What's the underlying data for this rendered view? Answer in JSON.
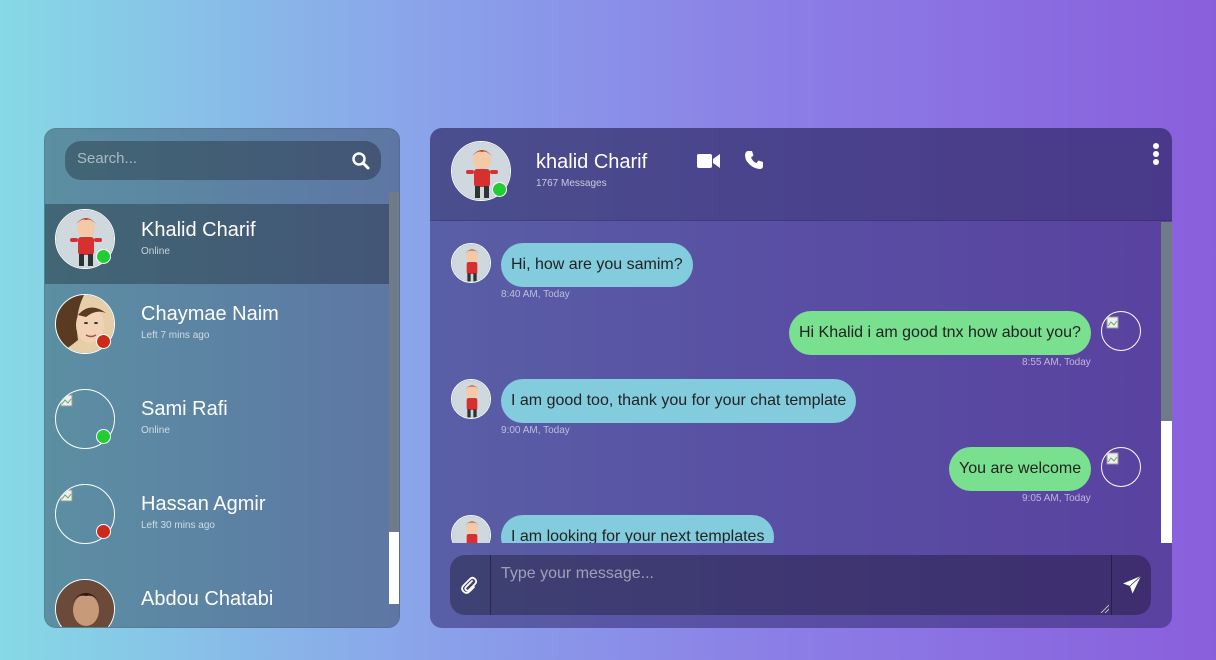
{
  "search": {
    "placeholder": "Search...",
    "icon": "search-icon"
  },
  "contacts": [
    {
      "name": "Khalid Charif",
      "status": "Online",
      "status_color": "#22cc33",
      "avatar": "cartoon-boy",
      "active": true
    },
    {
      "name": "Chaymae Naim",
      "status": "Left 7 mins ago",
      "status_color": "#cc2a1a",
      "avatar": "photo-woman",
      "active": false
    },
    {
      "name": "Sami Rafi",
      "status": "Online",
      "status_color": "#22cc33",
      "avatar": "broken-image",
      "active": false
    },
    {
      "name": "Hassan Agmir",
      "status": "Left 30 mins ago",
      "status_color": "#cc2a1a",
      "avatar": "broken-image",
      "active": false
    },
    {
      "name": "Abdou Chatabi",
      "status": "",
      "status_color": "#22cc33",
      "avatar": "photo-man",
      "active": false
    }
  ],
  "chat": {
    "name": "khalid Charif",
    "message_count": "1767 Messages",
    "online_color": "#22cc33",
    "header_icons": [
      "video-camera-icon",
      "phone-icon",
      "more-vertical-icon"
    ]
  },
  "messages": [
    {
      "direction": "in",
      "text": "Hi, how are you samim?",
      "time": "8:40 AM, Today"
    },
    {
      "direction": "out",
      "text": "Hi Khalid i am good tnx how about you?",
      "time": "8:55 AM, Today"
    },
    {
      "direction": "in",
      "text": "I am good too, thank you for your chat template",
      "time": "9:00 AM, Today"
    },
    {
      "direction": "out",
      "text": "You are welcome",
      "time": "9:05 AM, Today"
    },
    {
      "direction": "in",
      "text": "I am looking for your next templates",
      "time": ""
    }
  ],
  "composer": {
    "placeholder": "Type your message...",
    "attach_icon": "paperclip-icon",
    "send_icon": "send-icon"
  },
  "colors": {
    "incoming_bubble": "#82ccdd",
    "outgoing_bubble": "#78e08f"
  }
}
